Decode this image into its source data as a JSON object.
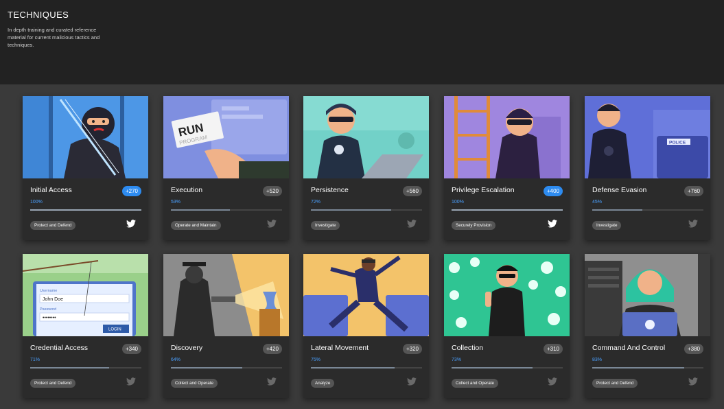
{
  "header": {
    "title": "TECHNIQUES",
    "subtitle": "In depth training and curated reference material for current malicious tactics and techniques."
  },
  "cards": [
    {
      "title": "Initial Access",
      "points": "+270",
      "percent": "100%",
      "progress": 1.0,
      "completed": true,
      "category": "Protect and Defend",
      "share_icon": "twitter-icon",
      "bg": "#4d97e6"
    },
    {
      "title": "Execution",
      "points": "+520",
      "percent": "53%",
      "progress": 0.53,
      "completed": false,
      "category": "Operate and Maintain",
      "share_icon": "twitter-icon",
      "bg": "#7f8fe0",
      "run_text": "RUN",
      "program_text": "PROGRAM"
    },
    {
      "title": "Persistence",
      "points": "+560",
      "percent": "72%",
      "progress": 0.72,
      "completed": false,
      "category": "Investigate",
      "share_icon": "twitter-icon",
      "bg": "#72d1c8"
    },
    {
      "title": "Privilege Escalation",
      "points": "+400",
      "percent": "100%",
      "progress": 1.0,
      "completed": true,
      "category": "Securely Provision",
      "share_icon": "twitter-icon",
      "bg": "#9f86df"
    },
    {
      "title": "Defense Evasion",
      "points": "+760",
      "percent": "45%",
      "progress": 0.45,
      "completed": false,
      "category": "Investigate",
      "share_icon": "twitter-icon",
      "bg": "#5f6fd8",
      "police_text": "POLICE"
    },
    {
      "title": "Credential Access",
      "points": "+340",
      "percent": "71%",
      "progress": 0.71,
      "completed": false,
      "category": "Protect and Defend",
      "share_icon": "twitter-icon",
      "bg": "#9ad08a",
      "login": {
        "username_label": "Username",
        "username_value": "John Doe",
        "password_label": "Password",
        "password_value": "••••••••",
        "button": "LOGIN"
      }
    },
    {
      "title": "Discovery",
      "points": "+420",
      "percent": "64%",
      "progress": 0.64,
      "completed": false,
      "category": "Collect and Operate",
      "share_icon": "twitter-icon",
      "bg": "#8c8c8c"
    },
    {
      "title": "Lateral Movement",
      "points": "+320",
      "percent": "75%",
      "progress": 0.75,
      "completed": false,
      "category": "Analyze",
      "share_icon": "twitter-icon",
      "bg": "#f3c36a"
    },
    {
      "title": "Collection",
      "points": "+310",
      "percent": "73%",
      "progress": 0.73,
      "completed": false,
      "category": "Collect and Operate",
      "share_icon": "twitter-icon",
      "bg": "#2fc593"
    },
    {
      "title": "Command And Control",
      "points": "+380",
      "percent": "83%",
      "progress": 0.83,
      "completed": false,
      "category": "Protect and Defend",
      "share_icon": "twitter-icon",
      "bg": "#8f8f8f"
    }
  ]
}
